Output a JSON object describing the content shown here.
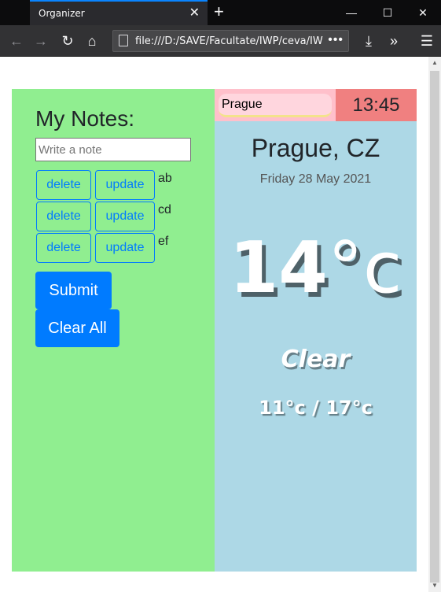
{
  "browser": {
    "tab_title": "Organizer",
    "url": "file:///D:/SAVE/Facultate/IWP/ceva/IWP",
    "icons": {
      "close": "close-icon",
      "new_tab": "plus-icon",
      "back": "back-arrow-icon",
      "forward": "forward-arrow-icon",
      "reload": "reload-icon",
      "home": "home-icon",
      "page": "page-icon",
      "more": "more-icon",
      "download": "download-icon",
      "overflow": "overflow-icon",
      "menu": "hamburger-menu-icon"
    }
  },
  "notes": {
    "title": "My Notes:",
    "input_placeholder": "Write a note",
    "items": [
      {
        "delete_label": "delete",
        "update_label": "update",
        "text": "ab"
      },
      {
        "delete_label": "delete",
        "update_label": "update",
        "text": "cd"
      },
      {
        "delete_label": "delete",
        "update_label": "update",
        "text": "ef"
      }
    ],
    "submit_label": "Submit",
    "clear_label": "Clear All",
    "colors": {
      "panel": "#90ee90",
      "accent": "#007bff"
    }
  },
  "weather": {
    "city_input_value": "Prague",
    "time": "13:45",
    "location": "Prague, CZ",
    "date": "Friday 28 May 2021",
    "temperature": "14",
    "temp_unit": "°c",
    "condition": "Clear",
    "hi_lo": "11°c / 17°c",
    "colors": {
      "panel": "#add8e6",
      "search_bg": "#ffc0cb",
      "clock_bg": "#f08080"
    }
  }
}
